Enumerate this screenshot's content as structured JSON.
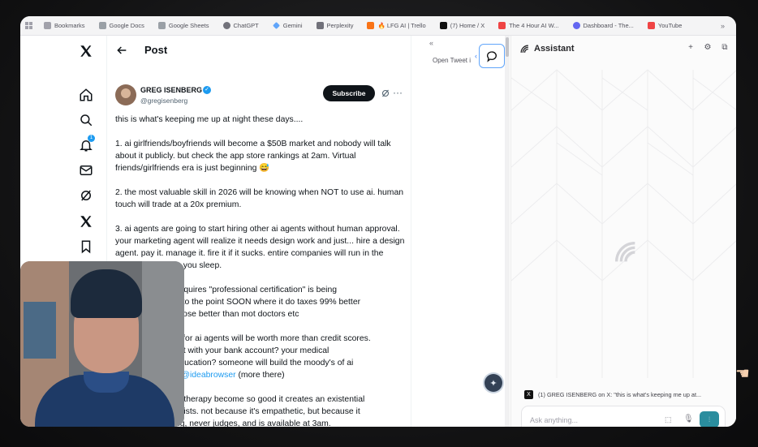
{
  "bookmarks": [
    {
      "label": "Bookmarks",
      "icon": "bookmark-icon",
      "color": "#a1a1aa"
    },
    {
      "label": "Google Docs",
      "icon": "docs-icon",
      "color": "#9aa0a6"
    },
    {
      "label": "Google Sheets",
      "icon": "sheets-icon",
      "color": "#9aa0a6"
    },
    {
      "label": "ChatGPT",
      "icon": "chatgpt-icon",
      "color": "#71717a"
    },
    {
      "label": "Gemini",
      "icon": "gemini-icon",
      "color": "#60a5fa"
    },
    {
      "label": "Perplexity",
      "icon": "perplexity-icon",
      "color": "#71717a"
    },
    {
      "label": "🔥 LFG AI | Trello",
      "icon": "trello-icon",
      "color": "#f97316"
    },
    {
      "label": "(7) Home / X",
      "icon": "x-icon",
      "color": "#111111"
    },
    {
      "label": "The 4 Hour AI W...",
      "icon": "substack-icon",
      "color": "#ef4444"
    },
    {
      "label": "Dashboard - The...",
      "icon": "dashboard-icon",
      "color": "#6366f1"
    },
    {
      "label": "YouTube",
      "icon": "youtube-icon",
      "color": "#ef4444"
    }
  ],
  "bookmarks_more": "»",
  "x_nav": {
    "notification_count": "1"
  },
  "post": {
    "header_title": "Post",
    "author_name": "GREG ISENBERG",
    "author_handle": "@gregisenberg",
    "subscribe_label": "Subscribe",
    "more_label": "···",
    "paragraphs": [
      "this is what's keeping me up at night these days....",
      "1. ai girlfriends/boyfriends will become a $50B market and nobody will talk about it publicly. but check the app store rankings at 2am. Virtual friends/girlfriends era is just beginning 😅",
      "2. the most valuable skill in 2026 will be knowing when NOT to use ai. human touch will trade at a 20x premium.",
      "3. ai agents are going to start hiring other ai agents without human approval. your marketing agent will realize it needs design work and just... hire a design agent. pay it. manage it. fire it if it sucks. entire companies will run in the background while you sleep.",
      "                    hat requires \"professional certification\" is being\n                    ll get to the point SOON where it do taxes 99% better\n                    diagnose better than mot doctors etc",
      "                    tems for ai agents will be worth more than credit scores.\n                    u trust with your bank account? your medical\n                    ds' education? someone will build the moody's of ai\n                    from ",
      "                    ee AI therapy become so good it creates an existential\n                    herapists. not because it's empathetic, but because it\n                    ything, never judges, and is available at 3am."
    ],
    "link_text": "@ideabrowser",
    "link_suffix": " (more there)"
  },
  "sidebar_tools": {
    "collapse_label": "«",
    "open_tweet_label": "Open Tweet i",
    "chevron": "‹"
  },
  "assistant": {
    "title": "Assistant",
    "actions": [
      "+",
      "⚙",
      "⧉"
    ],
    "context_text": "(1) GREG ISENBERG on X: \"this is what's keeping me up at...",
    "context_icon": "X",
    "input_placeholder": "Ask anything...",
    "send_glyph": "⫶"
  },
  "colors": {
    "accent": "#2a8d9e",
    "x_blue": "#1d9bf0",
    "dark": "#0f1419"
  }
}
